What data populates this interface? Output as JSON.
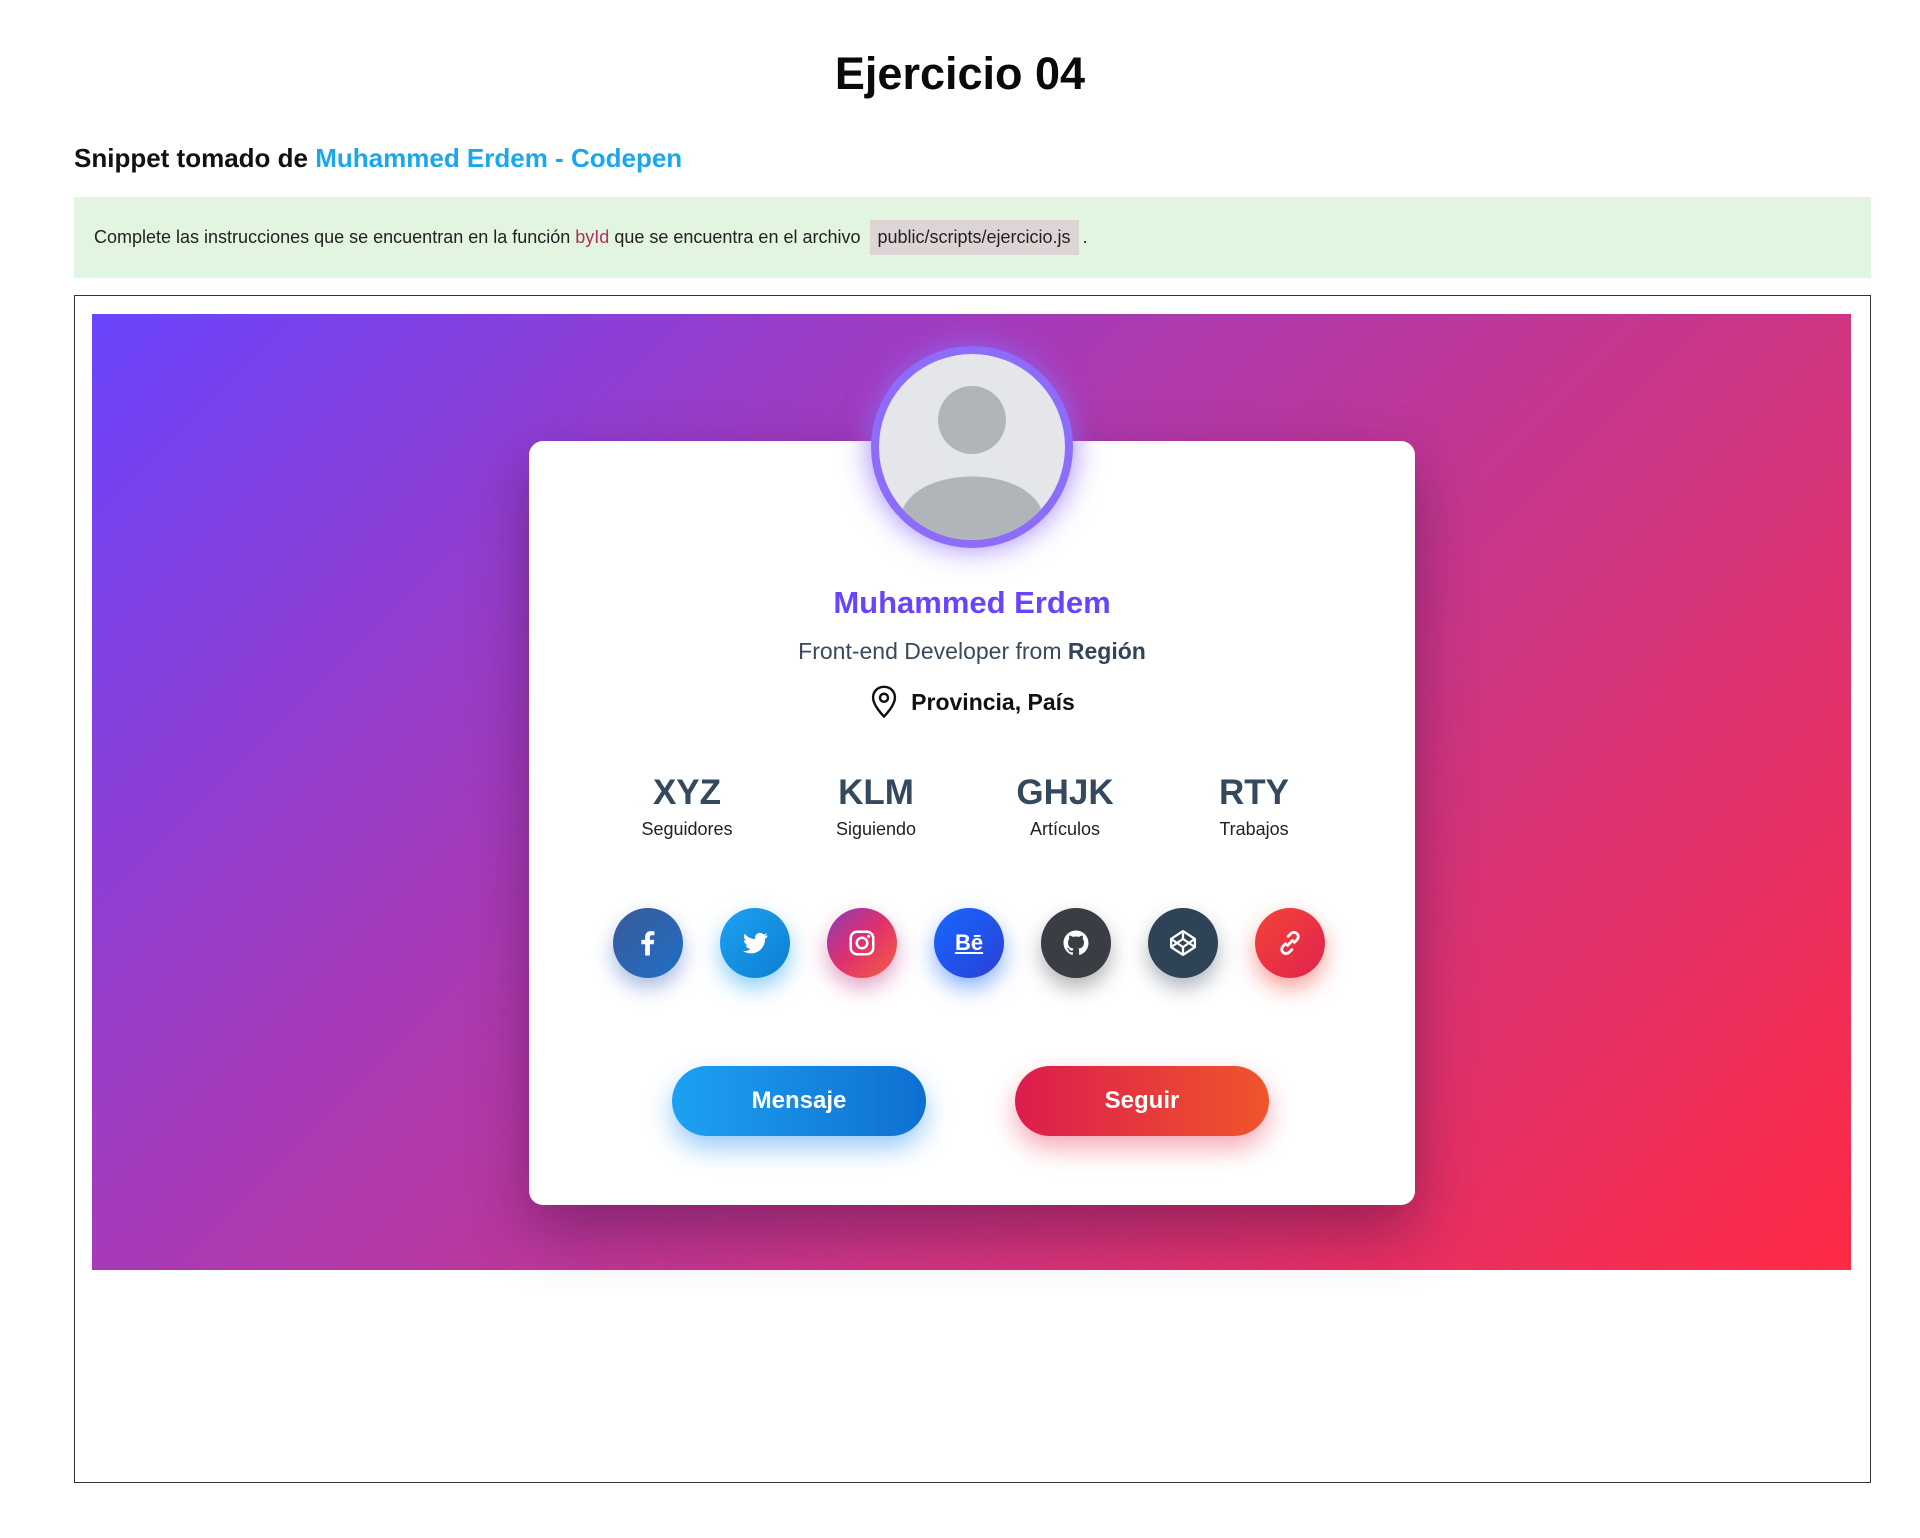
{
  "page": {
    "title": "Ejercicio 04",
    "snippet_prefix": "Snippet tomado de",
    "snippet_link": "Muhammed Erdem - Codepen"
  },
  "notice": {
    "text_before": "Complete las instrucciones que se encuentran en la función",
    "function_name": "byId",
    "text_middle": "que se encuentra en el archivo",
    "file_path": "public/scripts/ejercicio.js",
    "text_end": "."
  },
  "profile": {
    "name": "Muhammed Erdem",
    "role_prefix": "Front-end Developer from",
    "region": "Región",
    "location": "Provincia, País"
  },
  "stats": [
    {
      "value": "XYZ",
      "label": "Seguidores"
    },
    {
      "value": "KLM",
      "label": "Siguiendo"
    },
    {
      "value": "GHJK",
      "label": "Artículos"
    },
    {
      "value": "RTY",
      "label": "Trabajos"
    }
  ],
  "social": [
    {
      "icon": "facebook-icon",
      "color": "#3b5998"
    },
    {
      "icon": "twitter-icon",
      "color": "#1da1f2"
    },
    {
      "icon": "instagram-icon",
      "color": "#c13584"
    },
    {
      "icon": "behance-icon",
      "color": "#1769ff",
      "label": "Bē"
    },
    {
      "icon": "github-icon",
      "color": "#3a3e44"
    },
    {
      "icon": "codepen-icon",
      "color": "#2f4357"
    },
    {
      "icon": "link-icon",
      "color": "#f44336"
    }
  ],
  "buttons": {
    "message": "Mensaje",
    "follow": "Seguir"
  },
  "colors": {
    "accent": "#6a44fc",
    "link": "#1aa7ec",
    "notice_bg": "#e1f5e1",
    "gradient_start": "#6a44fc",
    "gradient_end": "#ff2a45"
  }
}
